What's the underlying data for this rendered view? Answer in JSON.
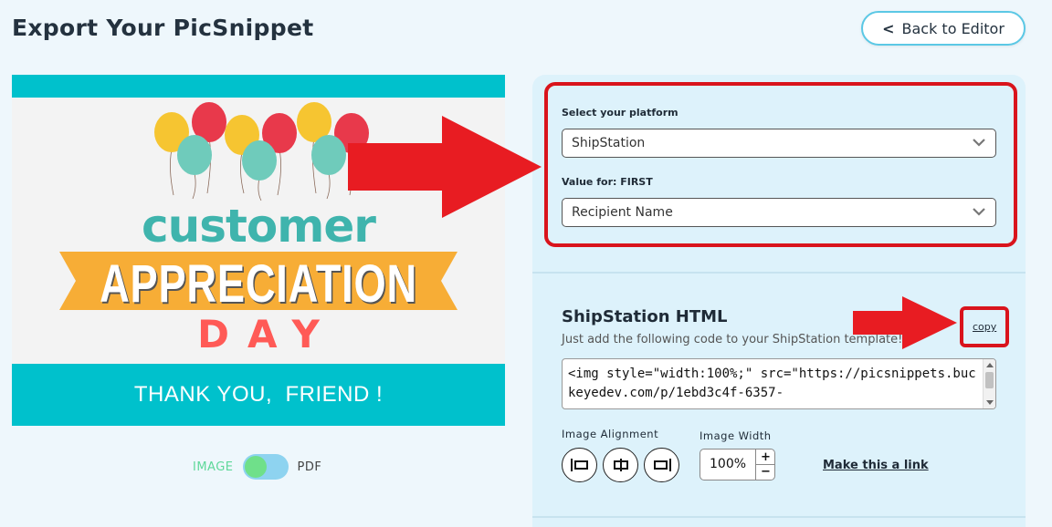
{
  "page": {
    "title": "Export Your PicSnippet"
  },
  "header": {
    "back_label": "Back to Editor",
    "back_icon": "chevron-left-icon"
  },
  "preview": {
    "line1": "customer",
    "line2": "APPRECIATION",
    "line3": "DAY",
    "footer": "THANK YOU,  FRIEND !",
    "colors": {
      "band": "#00c1cc",
      "ribbon": "#f7ad36",
      "customer": "#3fb4ad",
      "day": "#ff5a56"
    }
  },
  "format_toggle": {
    "left_label": "IMAGE",
    "right_label": "PDF",
    "selected": "IMAGE"
  },
  "settings": {
    "platform_label": "Select your platform",
    "platform_value": "ShipStation",
    "value_label": "Value for: FIRST",
    "value_value": "Recipient Name"
  },
  "html_section": {
    "title": "ShipStation HTML",
    "description": "Just add the following code to your ShipStation template!",
    "copy_label": "copy",
    "code": "<img style=\"width:100%;\" src=\"https://picsnippets.buckeyedev.com/p/1ebd3c4f-6357-"
  },
  "image_options": {
    "alignment_label": "Image Alignment",
    "alignment_buttons": [
      "align-left-icon",
      "align-center-icon",
      "align-right-icon"
    ],
    "width_label": "Image Width",
    "width_value": "100%",
    "plus": "+",
    "minus": "−",
    "make_link_label": "Make this a link"
  },
  "annotations": {
    "arrow_color": "#e81c22"
  }
}
